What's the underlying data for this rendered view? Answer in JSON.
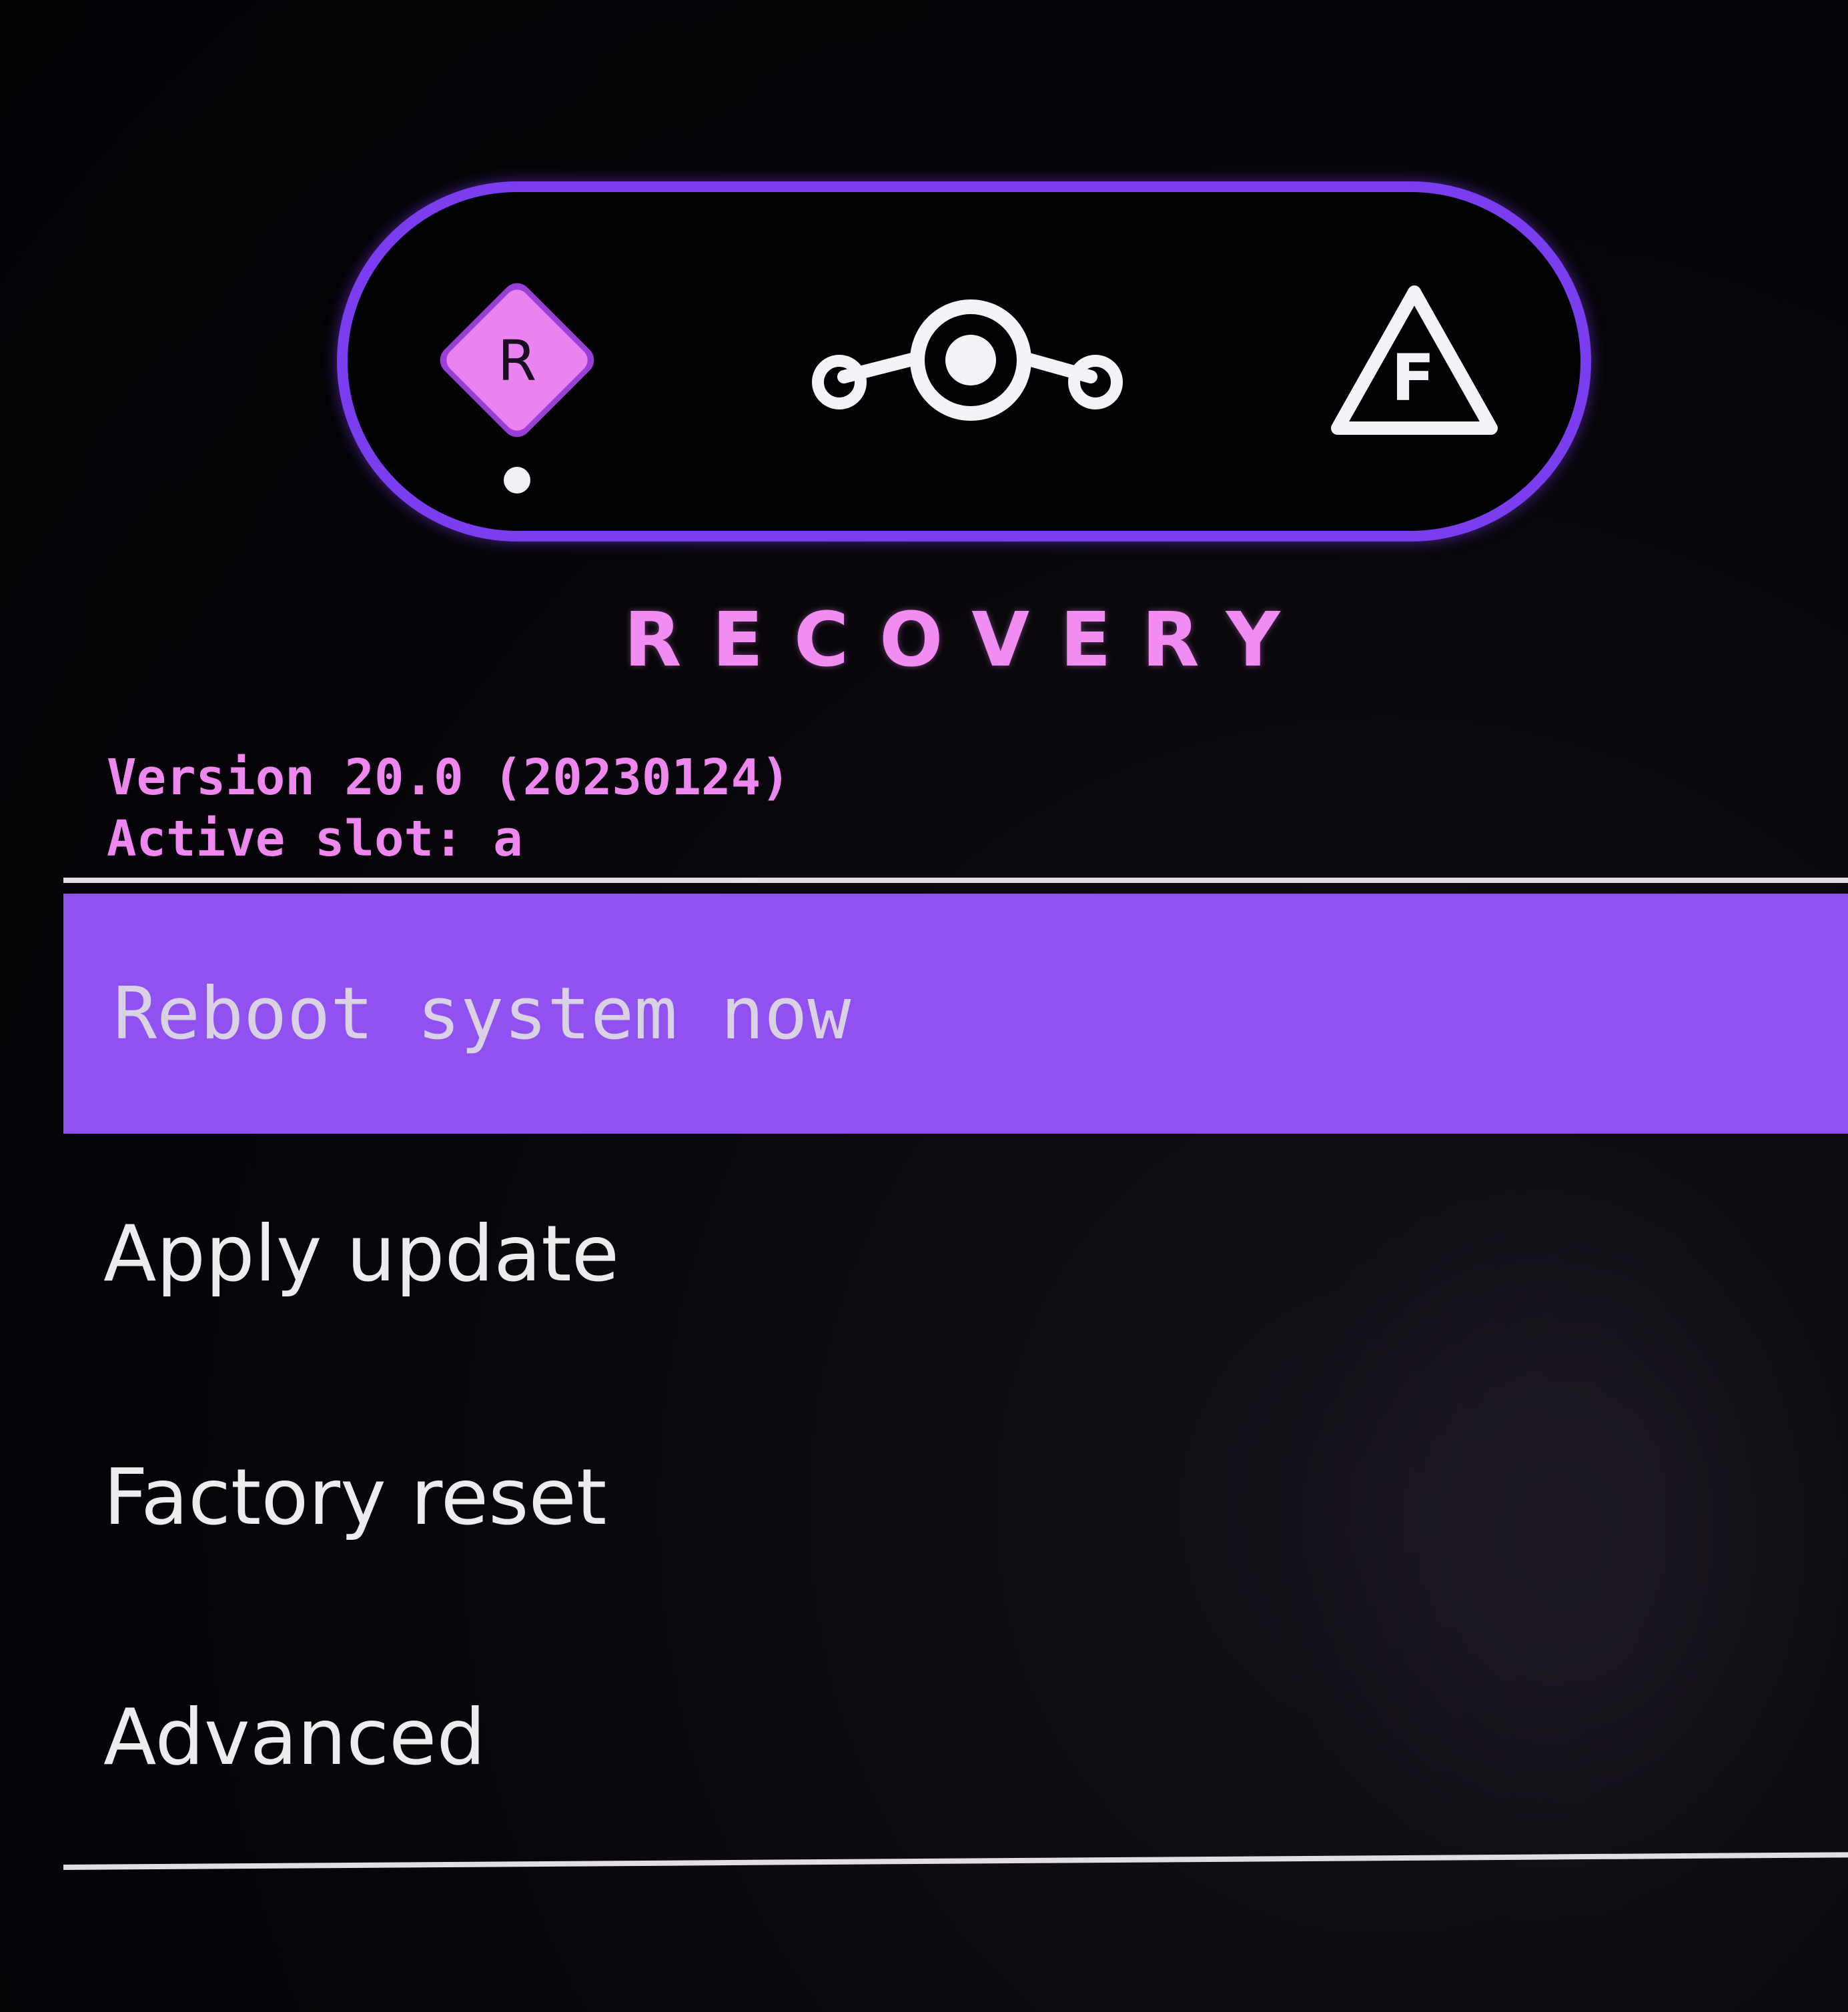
{
  "header": {
    "accent_color": "#7b3df0",
    "icons": [
      {
        "name": "recovery-icon",
        "letter": "R",
        "active": true,
        "color": "#ea83ef"
      },
      {
        "name": "lineageos-logo-icon"
      },
      {
        "name": "fastboot-icon",
        "letter": "F"
      }
    ],
    "mode_title": "RECOVERY"
  },
  "info": {
    "version": "Version 20.0 (20230124)",
    "active_slot": "Active slot: a"
  },
  "menu": {
    "selected_index": 0,
    "highlight_color": "#9150f0",
    "items": [
      {
        "label": "Reboot system now"
      },
      {
        "label": "Apply update"
      },
      {
        "label": "Factory reset"
      },
      {
        "label": "Advanced"
      }
    ]
  }
}
